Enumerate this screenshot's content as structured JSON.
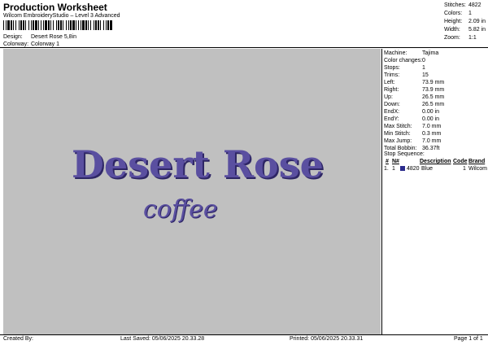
{
  "header": {
    "title": "Production Worksheet",
    "software": "Wilcom EmbroideryStudio – Level 3 Advanced",
    "barcode_text": "|||||||||||||||||||||||||||||||||||||||||||||||||||||||||||||||||",
    "design_label": "Design:",
    "design_value": "Desert Rose 5,8in",
    "colorway_label": "Colorway:",
    "colorway_value": "Colorway 1"
  },
  "stats": [
    {
      "label": "Stitches:",
      "value": "4822"
    },
    {
      "label": "Colors:",
      "value": "1"
    },
    {
      "label": "Height:",
      "value": "2.09 in"
    },
    {
      "label": "Width:",
      "value": "5.82 in"
    },
    {
      "label": "Zoom:",
      "value": "1:1"
    }
  ],
  "design": {
    "line1": "Desert Rose",
    "line2": "coffee",
    "thread_color": "#5a4fa0",
    "shadow_color": "#2e2665",
    "background": "#c0c0c0"
  },
  "machine_info": [
    {
      "label": "Machine:",
      "value": "Tajima"
    },
    {
      "label": "Color changes:",
      "value": "0"
    },
    {
      "label": "Stops:",
      "value": "1"
    },
    {
      "label": "Trims:",
      "value": "15"
    },
    {
      "label": "Left:",
      "value": "73.9 mm"
    },
    {
      "label": "Right:",
      "value": "73.9 mm"
    },
    {
      "label": "Up:",
      "value": "26.5 mm"
    },
    {
      "label": "Down:",
      "value": "26.5 mm"
    },
    {
      "label": "EndX:",
      "value": "0.00 in"
    },
    {
      "label": "EndY:",
      "value": "0.00 in"
    },
    {
      "label": "Max Stitch:",
      "value": "7.0 mm"
    },
    {
      "label": "Min Stitch:",
      "value": "0.3 mm"
    },
    {
      "label": "Max Jump:",
      "value": "7.0 mm"
    },
    {
      "label": "Total Bobbin:",
      "value": "36.37ft"
    }
  ],
  "stop_sequence": {
    "title": "Stop Sequence:",
    "columns": [
      "#",
      "N#",
      "Description",
      "Code",
      "Brand"
    ],
    "rows": [
      {
        "index": "1.",
        "n": "1",
        "stitches": "4820",
        "description": "Blue",
        "code": "1",
        "brand": "Wilcom",
        "color": "#2b2b8c"
      }
    ]
  },
  "footer": {
    "created_by": "Created By:",
    "last_saved": "Last Saved: 05/06/2025 20.33.28",
    "printed": "Printed: 05/06/2025 20.33.31",
    "page": "Page 1 of 1"
  }
}
